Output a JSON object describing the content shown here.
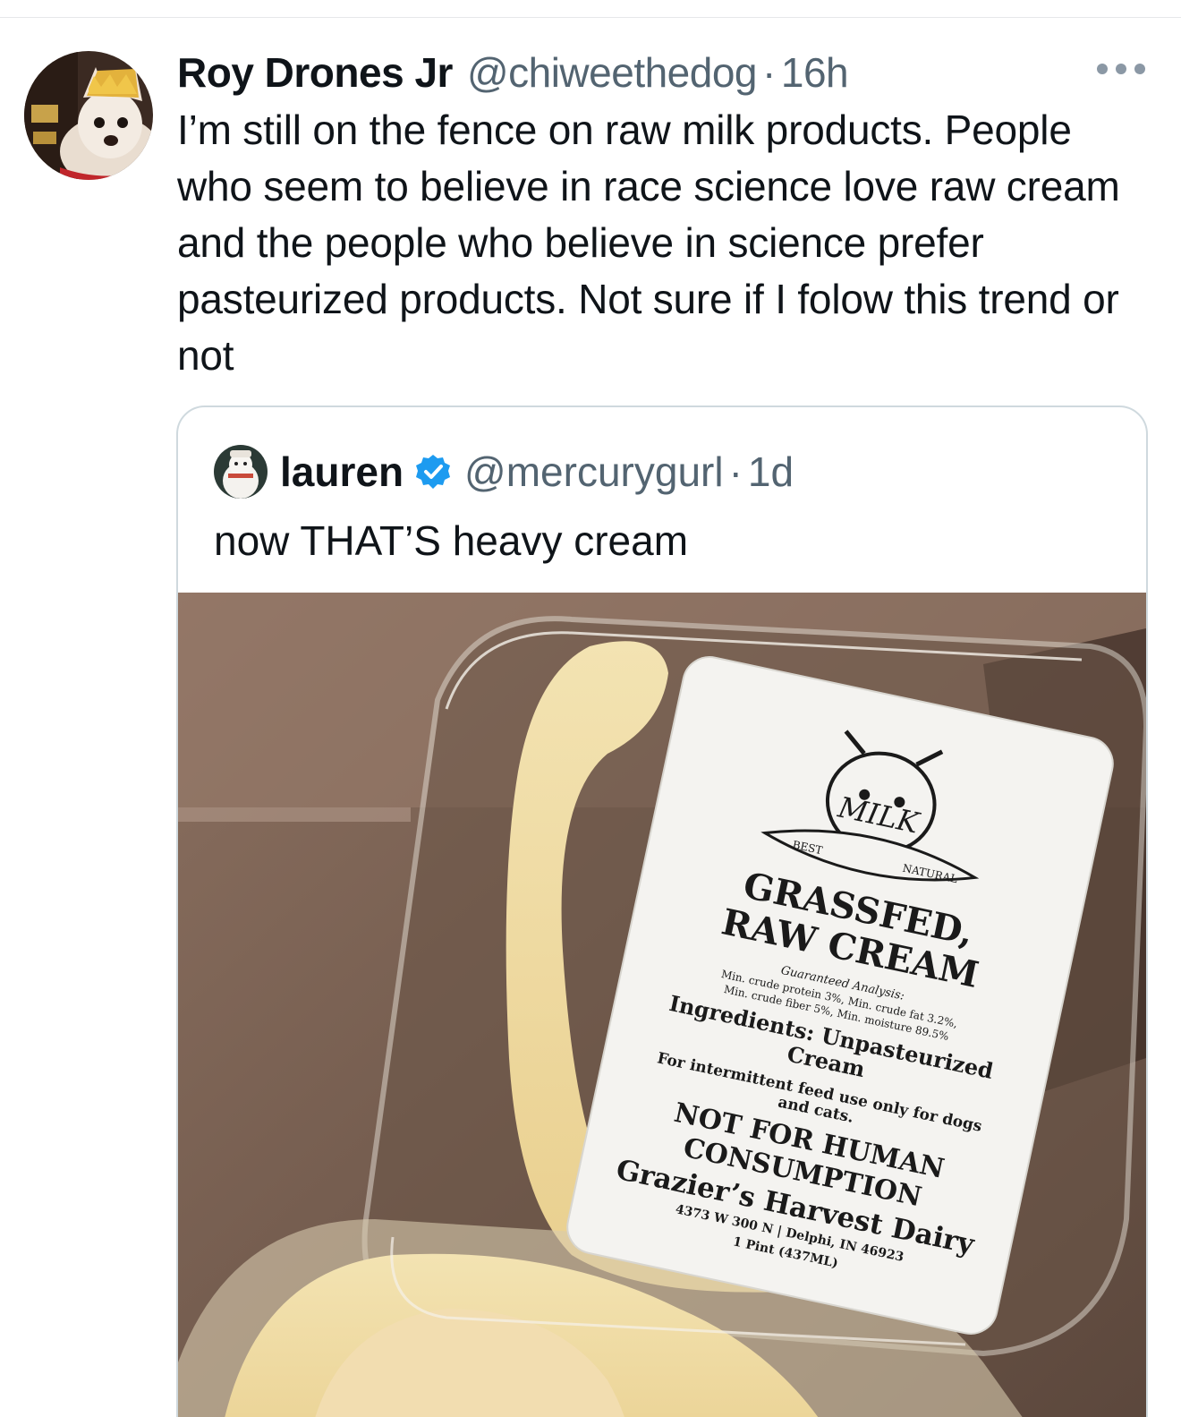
{
  "tweet": {
    "author": {
      "display_name": "Roy Drones Jr",
      "handle": "@chiweethedog",
      "avatar_icon": "dog-avatar-icon"
    },
    "separator": "·",
    "time": "16h",
    "more_icon": "more-options-icon",
    "text": "I’m still on the fence on raw milk products. People who seem to believe in race science love raw cream and the people who believe in science prefer pasteurized products. Not sure if I folow this trend or not"
  },
  "quoted_tweet": {
    "author": {
      "display_name": "lauren",
      "handle": "@mercurygurl",
      "verified": true,
      "avatar_icon": "snowman-avatar-icon"
    },
    "separator": "·",
    "time": "1d",
    "text": "now THAT’S heavy cream",
    "media": {
      "description_icon": "raw-cream-container-photo",
      "label": {
        "logo_word": "MILK",
        "logo_ribbon_left": "BEST",
        "logo_ribbon_right": "NATURAL",
        "title_line1": "GRASSFED,",
        "title_line2": "RAW CREAM",
        "analysis_heading": "Guaranteed Analysis:",
        "analysis_line1": "Min. crude protein 3%, Min. crude fat 3.2%,",
        "analysis_line2": "Min. crude fiber 5%, Min. moisture 89.5%",
        "ingredients_line1": "Ingredients: Unpasteurized",
        "ingredients_line2": "Cream",
        "usage_line1": "For intermittent feed use only for dogs",
        "usage_line2": "and cats.",
        "warning_line1": "NOT FOR HUMAN",
        "warning_line2": "CONSUMPTION",
        "dairy_name": "Grazier’s Harvest Dairy",
        "address": "4373 W 300 N | Delphi, IN 46923",
        "volume": "1 Pint (437ML)"
      }
    }
  },
  "colors": {
    "text_primary": "#0f1419",
    "text_secondary": "#536471",
    "border": "#cfd9de",
    "verified_blue": "#1d9bf0"
  }
}
